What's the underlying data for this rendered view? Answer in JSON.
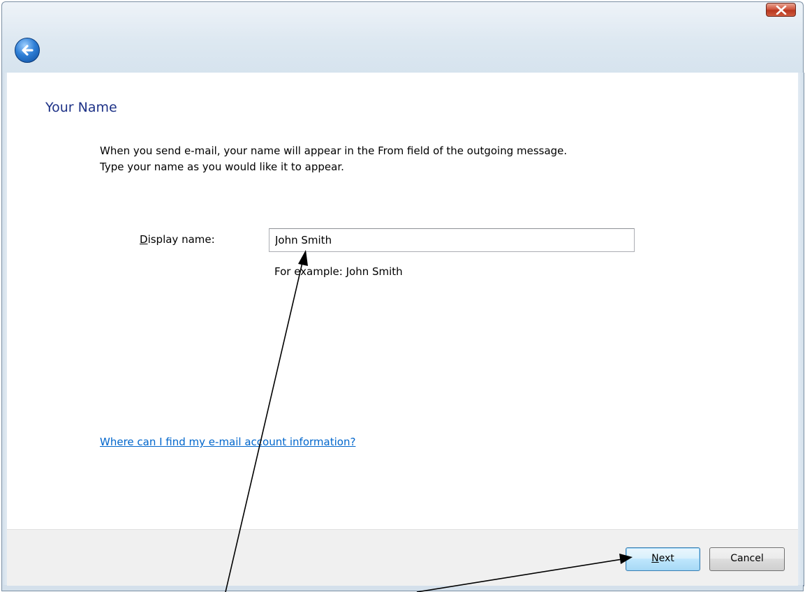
{
  "window": {
    "close_icon": "close-icon",
    "back_icon": "back-arrow-icon"
  },
  "page": {
    "title": "Your Name",
    "description_line1": "When you send e-mail, your name will appear in the From field of the outgoing message.",
    "description_line2": "Type your name as you would like it to appear."
  },
  "form": {
    "display_name_label_access_key": "D",
    "display_name_label_rest": "isplay name:",
    "display_name_value": "John Smith",
    "example_text": "For example: John Smith"
  },
  "help_link": "Where can I find my e-mail account information?",
  "buttons": {
    "next_access_key": "N",
    "next_rest": "ext",
    "cancel": "Cancel"
  },
  "annotations": {
    "arrow_color": "#000000"
  }
}
